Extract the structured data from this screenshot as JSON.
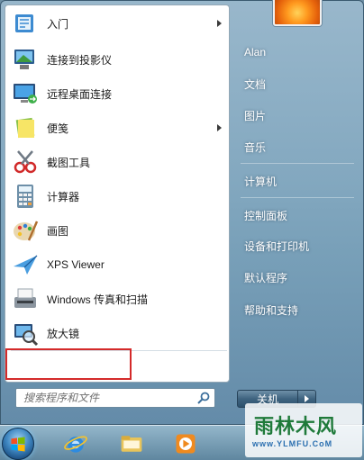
{
  "programs": [
    {
      "label": "入门",
      "icon": "getting-started-icon",
      "has_submenu": true
    },
    {
      "label": "连接到投影仪",
      "icon": "projector-icon",
      "has_submenu": false
    },
    {
      "label": "远程桌面连接",
      "icon": "remote-desktop-icon",
      "has_submenu": false
    },
    {
      "label": "便笺",
      "icon": "sticky-notes-icon",
      "has_submenu": true
    },
    {
      "label": "截图工具",
      "icon": "snipping-tool-icon",
      "has_submenu": false
    },
    {
      "label": "计算器",
      "icon": "calculator-icon",
      "has_submenu": false
    },
    {
      "label": "画图",
      "icon": "paint-icon",
      "has_submenu": false
    },
    {
      "label": "XPS Viewer",
      "icon": "xps-viewer-icon",
      "has_submenu": false
    },
    {
      "label": "Windows 传真和扫描",
      "icon": "fax-scan-icon",
      "has_submenu": false
    },
    {
      "label": "放大镜",
      "icon": "magnifier-icon",
      "has_submenu": false
    }
  ],
  "search": {
    "placeholder": "搜索程序和文件"
  },
  "places": [
    {
      "label": "Alan"
    },
    {
      "label": "文档"
    },
    {
      "label": "图片"
    },
    {
      "label": "音乐"
    },
    {
      "label": "计算机"
    },
    {
      "label": "控制面板"
    },
    {
      "label": "设备和打印机"
    },
    {
      "label": "默认程序"
    },
    {
      "label": "帮助和支持"
    }
  ],
  "shutdown": {
    "label": "关机"
  },
  "watermark": {
    "main": "雨林木风",
    "url": "www.YLMFU.CoM"
  },
  "colors": {
    "highlight": "#d42a2a",
    "menu_bg": "#ffffff",
    "accent": "#3f6480"
  }
}
